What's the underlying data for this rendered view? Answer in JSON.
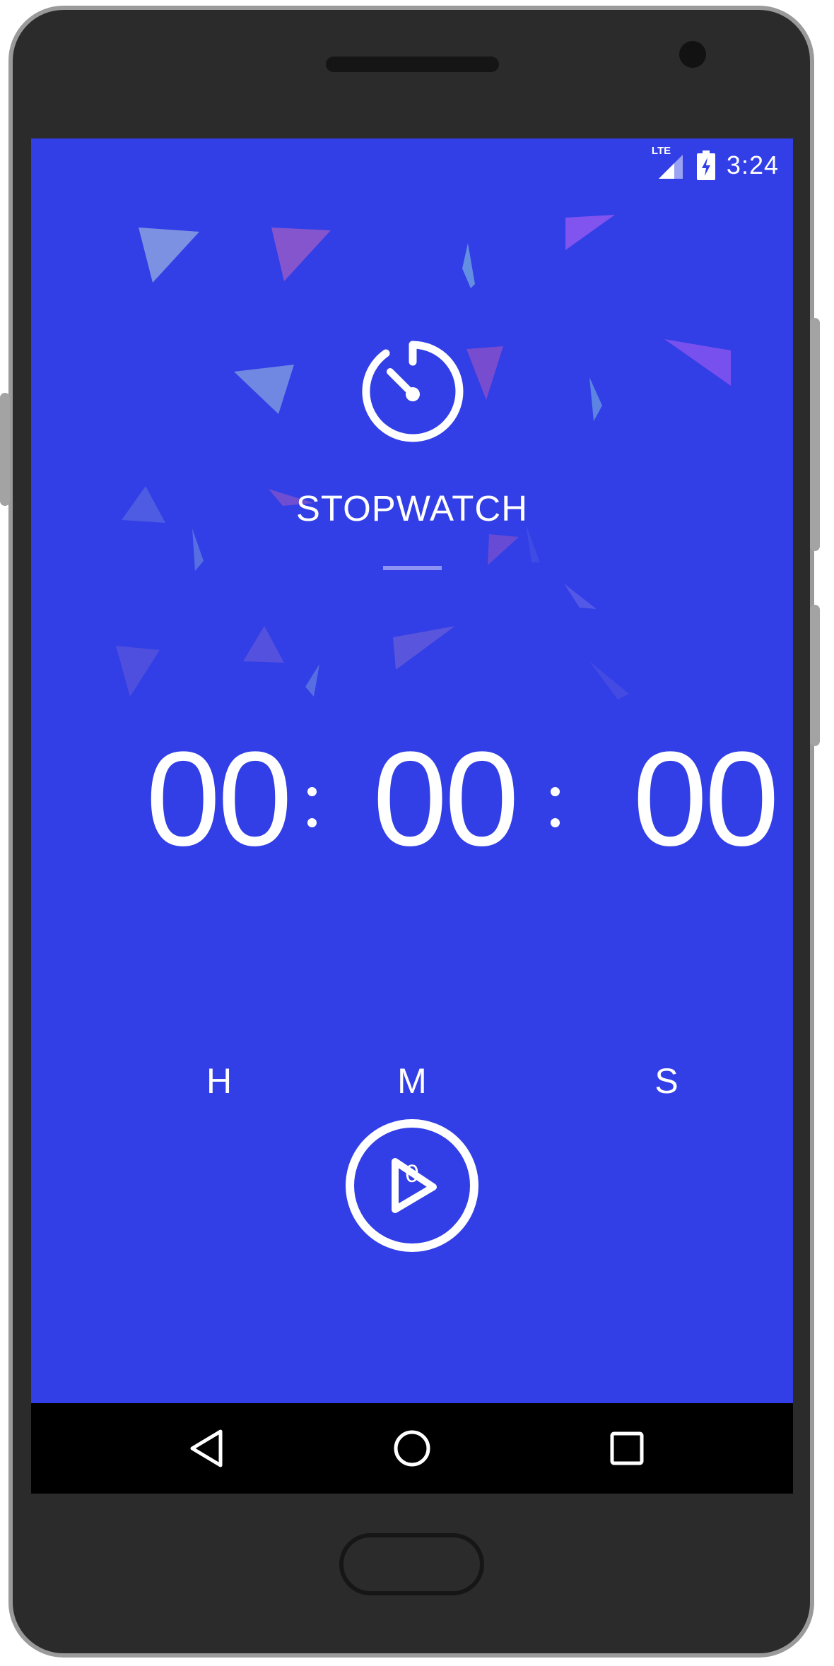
{
  "status_bar": {
    "network": "LTE",
    "time": "3:24",
    "icons": [
      "lte-signal-icon",
      "battery-charging-icon"
    ]
  },
  "app": {
    "icon": "stopwatch-icon",
    "title": "STOPWATCH"
  },
  "timer": {
    "hours": "00",
    "minutes": "00",
    "seconds": "00",
    "hours_label": "H",
    "minutes_label": "M",
    "seconds_label": "S",
    "lap_count": "0"
  },
  "controls": {
    "play_icon": "play-icon"
  },
  "nav_bar": {
    "icons": [
      "back-icon",
      "home-icon",
      "recents-icon"
    ]
  },
  "colors": {
    "background": "#323ee6",
    "foreground": "#ffffff",
    "accent_underline": "#8c93f2",
    "nav_bar": "#000000",
    "device_body": "#2b2b2b"
  }
}
